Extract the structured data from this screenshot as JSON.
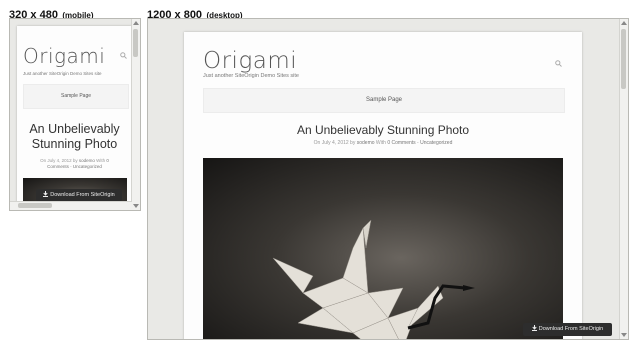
{
  "labels": {
    "mobile_size": "320 x 480",
    "mobile_kind": "(mobile)",
    "desktop_size": "1200 x 800",
    "desktop_kind": "(desktop)"
  },
  "site": {
    "logo": "Origami",
    "tagline": "Just another SiteOrigin Demo Sites site",
    "menu_item": "Sample Page",
    "post_title": "An Unbelievably Stunning Photo",
    "mobile_title_line1": "An Unbelievably",
    "mobile_title_line2": "Stunning Photo",
    "meta_prefix": "On July 4, 2012 by",
    "meta_author": "sodemo",
    "meta_with": "With",
    "meta_comments": "0 Comments",
    "meta_sep": "-",
    "meta_category": "Uncategorized",
    "mobile_meta_line1_prefix": "On July 4, 2012 by",
    "mobile_meta_line1_author": "sodemo",
    "mobile_meta_line1_with": "With",
    "mobile_meta_line1_zero": "0",
    "mobile_meta_line2_comments": "Comments",
    "mobile_meta_line2_sep": "-",
    "mobile_meta_line2_category": "Uncategorized"
  },
  "download_button": {
    "label": "Download From SiteOrigin",
    "icon": "download-arrow-icon"
  },
  "icons": {
    "search": "search-icon"
  },
  "colors": {
    "page_bg": "#fdfdfd",
    "frame_bg": "#e9e9e6",
    "menu_bg": "#f4f4f4",
    "button_bg": "#2d2d2d"
  }
}
